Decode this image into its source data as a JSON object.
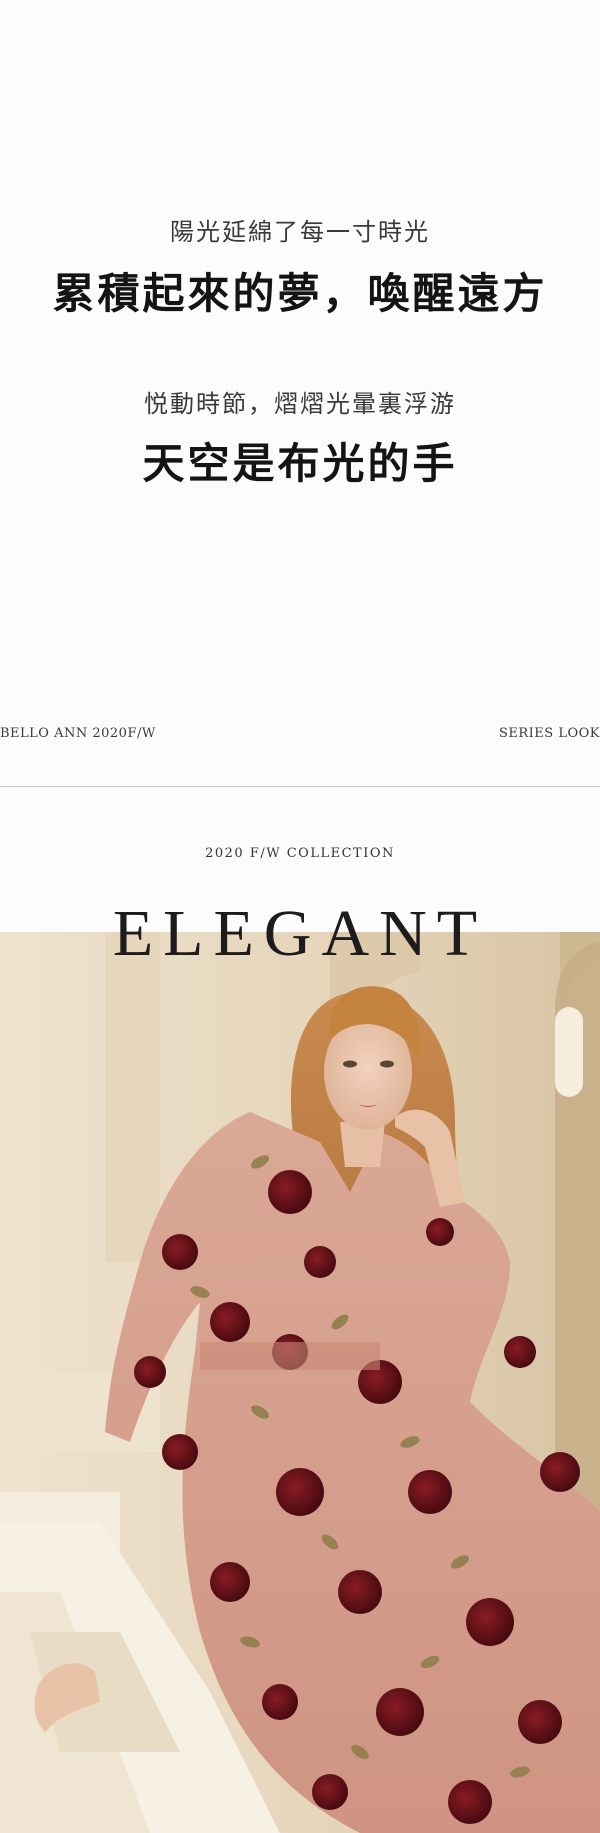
{
  "poem1": {
    "subtitle": "陽光延綿了每一寸時光",
    "title": "累積起來的夢，喚醒遠方"
  },
  "poem2": {
    "subtitle": "悦動時節，熠熠光暈裏浮游",
    "title": "天空是布光的手"
  },
  "footer": {
    "brand_season": "BELLO ANN 2020F/W",
    "series": "SERIES LOOK"
  },
  "collection": {
    "label": "2020 F/W COLLECTION",
    "headline": "ELEGANT"
  },
  "colors": {
    "background": "#fcfcfd",
    "text": "#141414",
    "dress": "#d9a08f",
    "rose": "#5a0f17",
    "wall": "#e6d6bc"
  },
  "photo": {
    "subject": "model-in-floral-dress-image"
  }
}
